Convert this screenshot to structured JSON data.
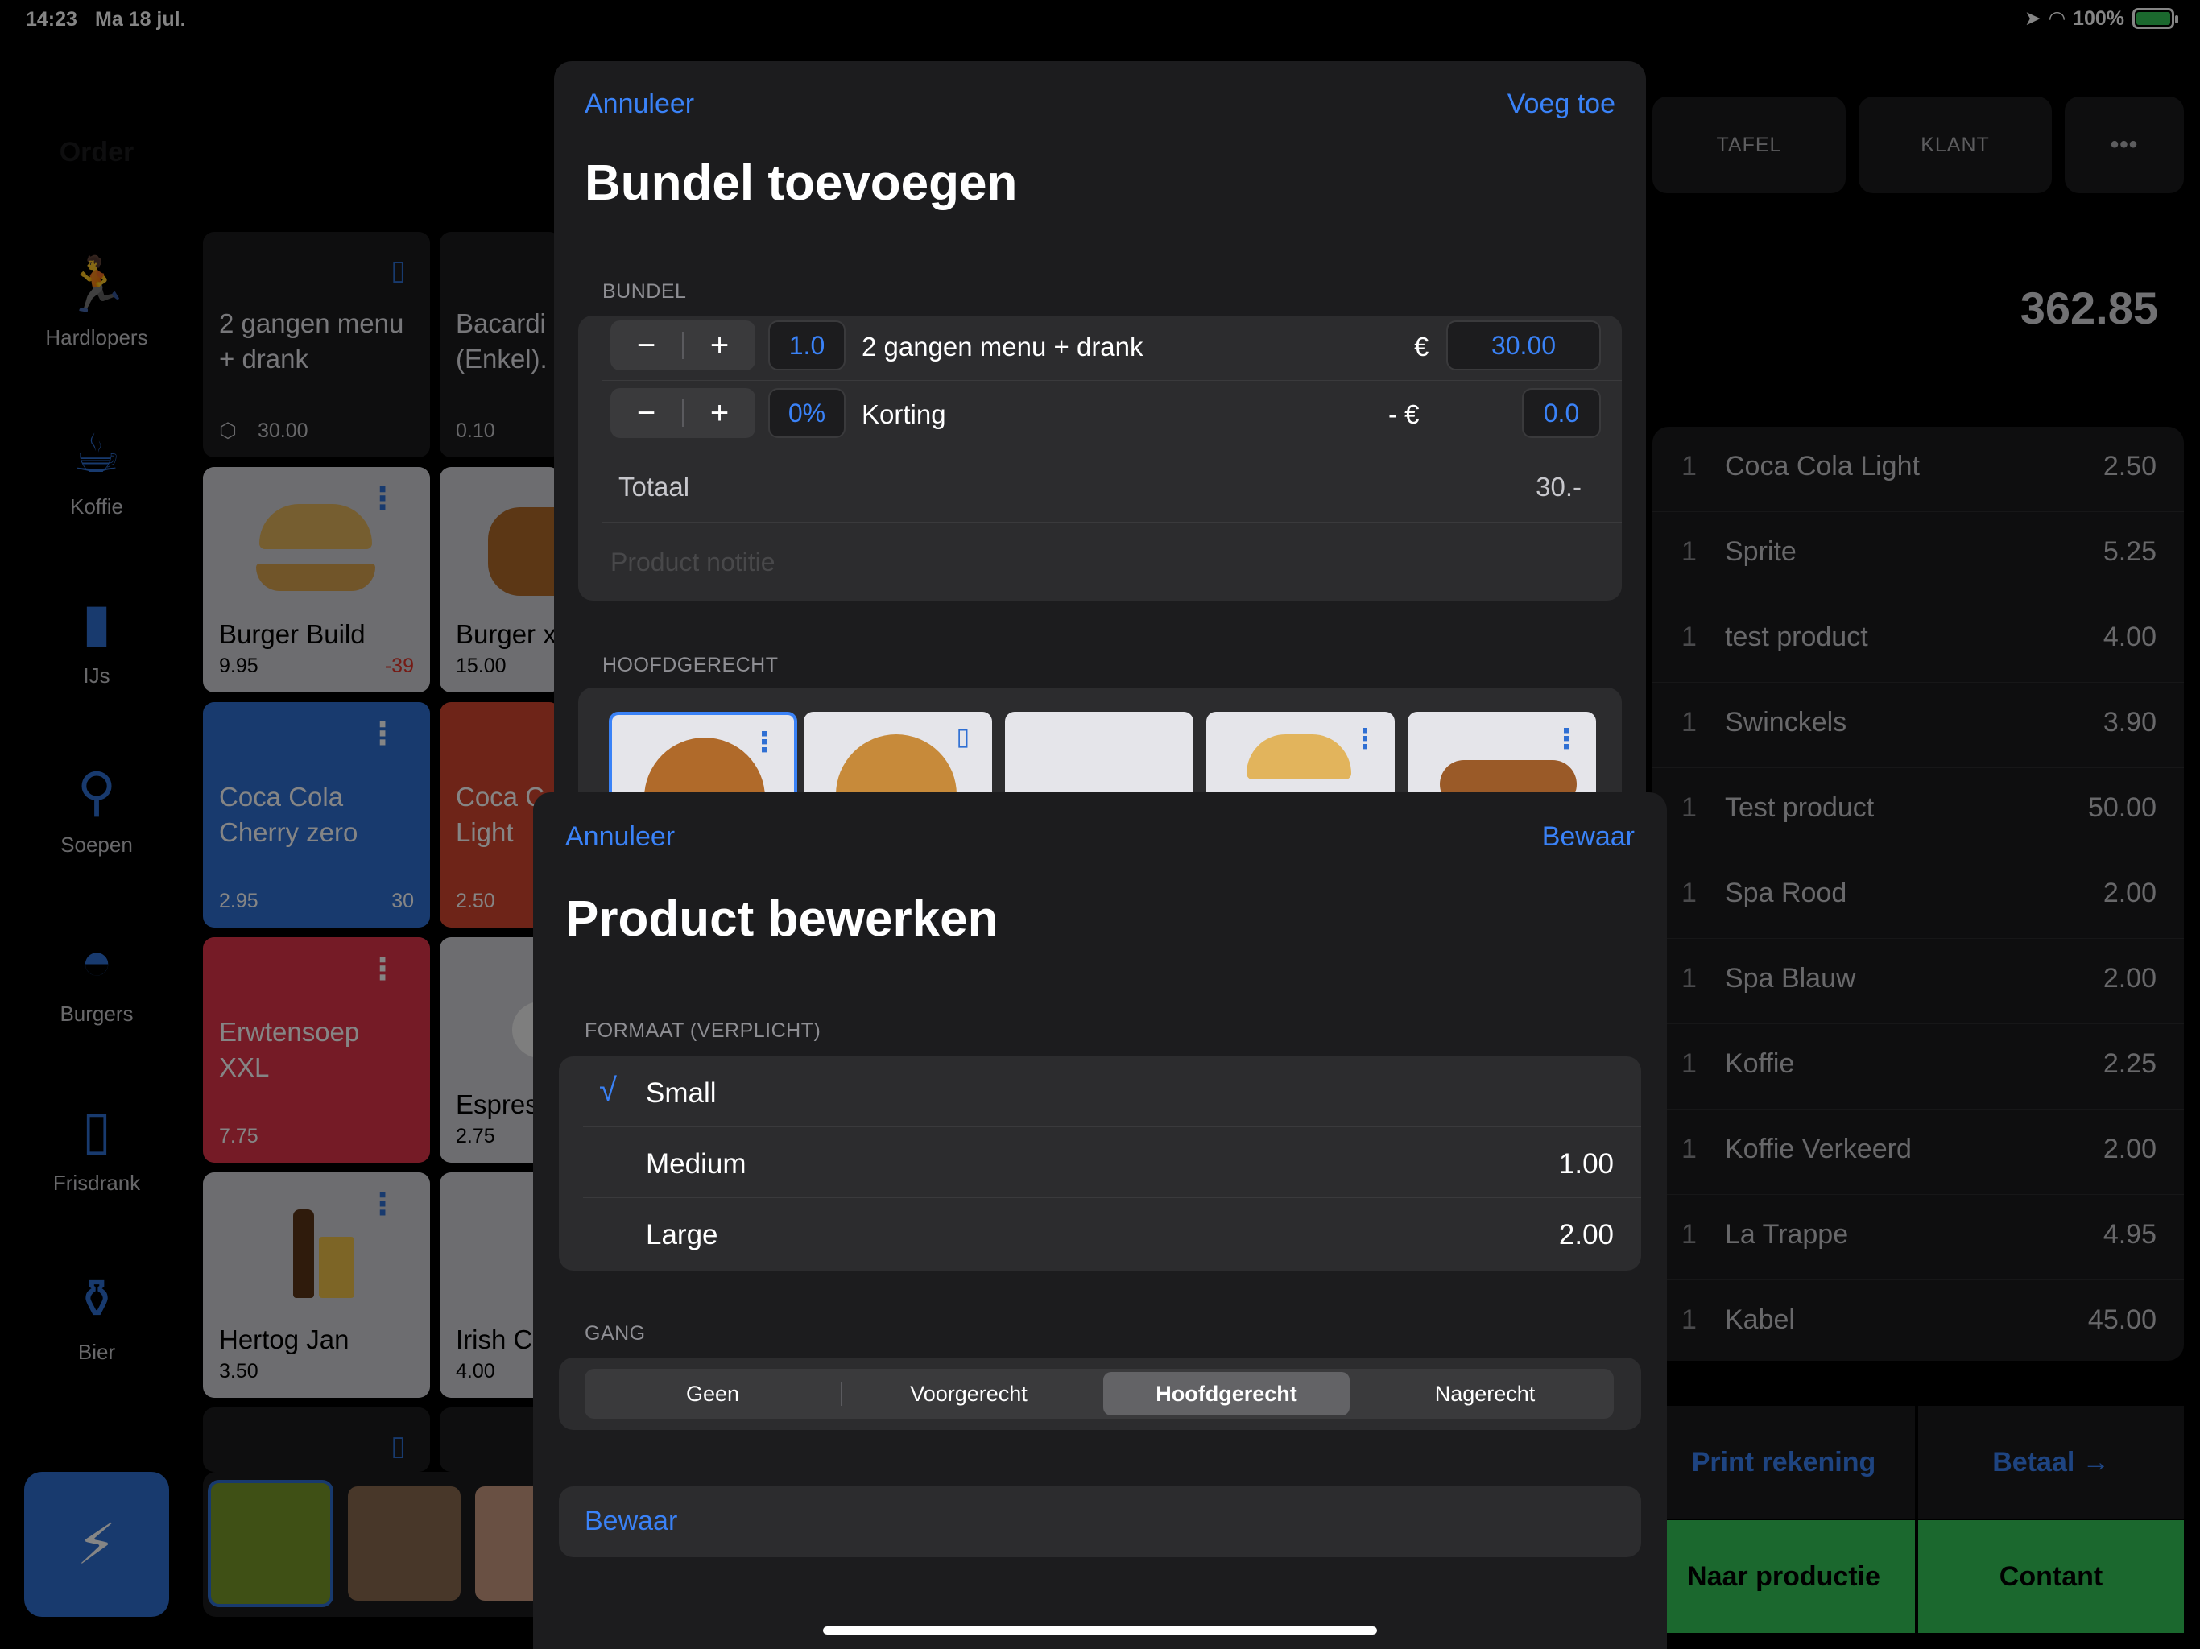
{
  "status": {
    "time": "14:23",
    "date": "Ma 18 jul.",
    "battery": "100%"
  },
  "sidebar": {
    "title": "Order",
    "items": [
      {
        "label": "Hardlopers",
        "icon": "runner-icon"
      },
      {
        "label": "Koffie",
        "icon": "coffee-cup-icon"
      },
      {
        "label": "IJs",
        "icon": "ice-cream-icon"
      },
      {
        "label": "Soepen",
        "icon": "spoon-icon"
      },
      {
        "label": "Burgers",
        "icon": "burger-icon"
      },
      {
        "label": "Frisdrank",
        "icon": "bottle-icon"
      },
      {
        "label": "Bier",
        "icon": "beer-bottles-icon"
      }
    ]
  },
  "grid": {
    "t1": {
      "name": "2 gangen menu + drank",
      "price": "30.00"
    },
    "t2": {
      "name": "Bacardi (Enkel).",
      "price": "0.10"
    },
    "t3": {
      "name": "Burger Build",
      "price": "9.95",
      "extra": "-39"
    },
    "t4": {
      "name": "Burger x",
      "price": "15.00"
    },
    "t5": {
      "name": "Coca Cola Cherry zero",
      "price": "2.95",
      "extra": "30"
    },
    "t6": {
      "name": "Coca C Light",
      "price": "2.50"
    },
    "t7": {
      "name": "Erwtensoep XXL",
      "price": "7.75"
    },
    "t8": {
      "name": "Espres",
      "price": "2.75"
    },
    "t9": {
      "name": "Hertog Jan",
      "price": "3.50"
    },
    "t10": {
      "name": "Irish C",
      "price": "4.00"
    }
  },
  "right": {
    "tafel": "TAFEL",
    "klant": "KLANT",
    "more": "•••",
    "total": "362.85",
    "lines": [
      {
        "qty": "1",
        "name": "Coca Cola Light",
        "price": "2.50"
      },
      {
        "qty": "1",
        "name": "Sprite",
        "price": "5.25"
      },
      {
        "qty": "1",
        "name": "test product",
        "price": "4.00"
      },
      {
        "qty": "1",
        "name": "Swinckels",
        "price": "3.90"
      },
      {
        "qty": "1",
        "name": "Test product",
        "price": "50.00"
      },
      {
        "qty": "1",
        "name": "Spa Rood",
        "price": "2.00"
      },
      {
        "qty": "1",
        "name": "Spa Blauw",
        "price": "2.00"
      },
      {
        "qty": "1",
        "name": "Koffie",
        "price": "2.25"
      },
      {
        "qty": "1",
        "name": "Koffie Verkeerd",
        "price": "2.00"
      },
      {
        "qty": "1",
        "name": "La Trappe",
        "price": "4.95"
      },
      {
        "qty": "1",
        "name": "Kabel",
        "price": "45.00"
      }
    ],
    "print": "Print rekening",
    "betaal": "Betaal →",
    "productie": "Naar productie",
    "contant": "Contant"
  },
  "bundel": {
    "cancel": "Annuleer",
    "add": "Voeg toe",
    "title": "Bundel toevoegen",
    "section": "BUNDEL",
    "item": {
      "qty": "1.0",
      "name": "2 gangen menu + drank",
      "currency": "€",
      "price": "30.00"
    },
    "discount": {
      "pct": "0%",
      "name": "Korting",
      "currency": "- €",
      "value": "0.0"
    },
    "total_label": "Totaal",
    "total_value": "30.-",
    "note_placeholder": "Product notitie",
    "main_section": "HOOFDGERECHT"
  },
  "product": {
    "cancel": "Annuleer",
    "save": "Bewaar",
    "title": "Product bewerken",
    "format_label": "FORMAAT   (VERPLICHT)",
    "options": [
      {
        "label": "Small",
        "price": "",
        "check": "√"
      },
      {
        "label": "Medium",
        "price": "1.00",
        "check": ""
      },
      {
        "label": "Large",
        "price": "2.00",
        "check": ""
      }
    ],
    "gang_label": "GANG",
    "gang_options": [
      "Geen",
      "Voorgerecht",
      "Hoofdgerecht",
      "Nagerecht"
    ],
    "gang_selected": "Hoofdgerecht",
    "save_button": "Bewaar"
  }
}
